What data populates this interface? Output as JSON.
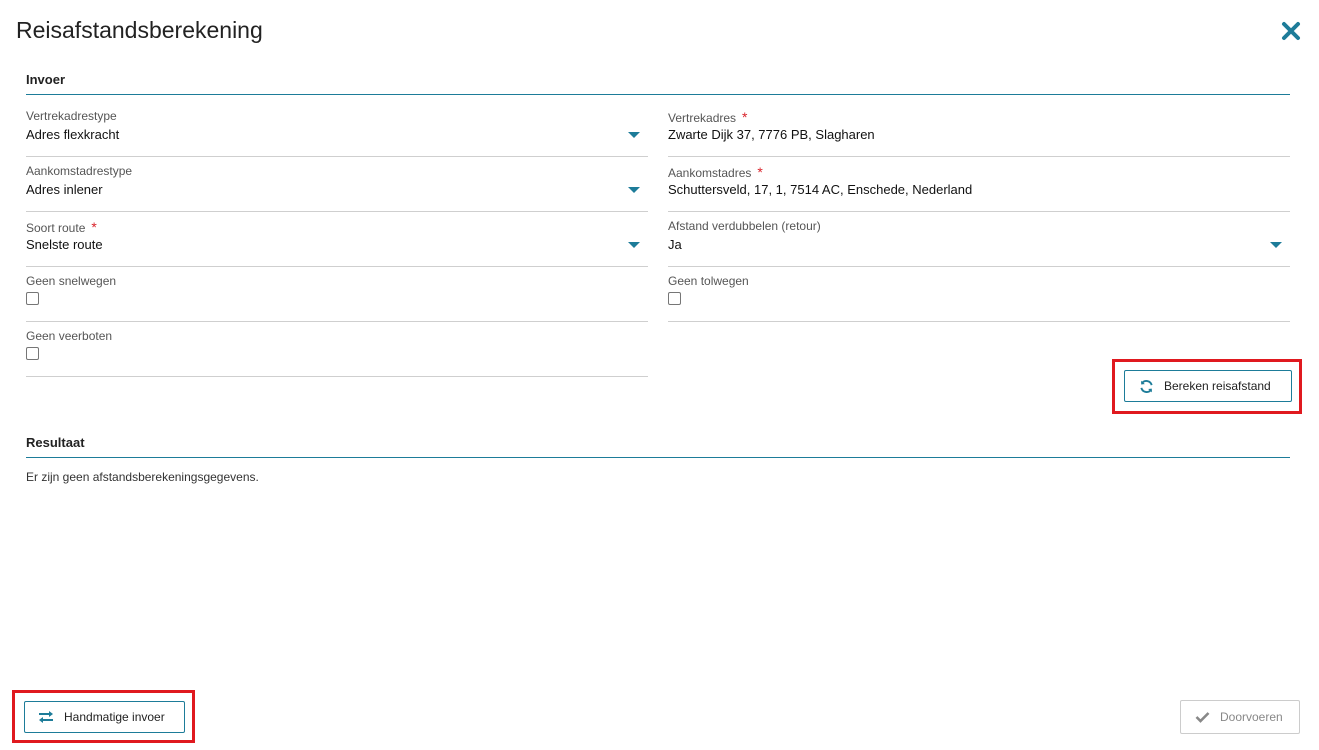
{
  "dialog": {
    "title": "Reisafstandsberekening"
  },
  "invoer": {
    "heading": "Invoer",
    "vertrekadrestype": {
      "label": "Vertrekadrestype",
      "value": "Adres flexkracht"
    },
    "vertrekadres": {
      "label": "Vertrekadres",
      "required": "*",
      "value": "Zwarte Dijk 37, 7776 PB, Slagharen"
    },
    "aankomstadrestype": {
      "label": "Aankomstadrestype",
      "value": "Adres inlener"
    },
    "aankomstadres": {
      "label": "Aankomstadres",
      "required": "*",
      "value": "Schuttersveld, 17, 1, 7514 AC, Enschede, Nederland"
    },
    "soort_route": {
      "label": "Soort route",
      "required": "*",
      "value": "Snelste route"
    },
    "afstand_verdubbelen": {
      "label": "Afstand verdubbelen (retour)",
      "value": "Ja"
    },
    "geen_snelwegen": {
      "label": "Geen snelwegen",
      "checked": false
    },
    "geen_tolwegen": {
      "label": "Geen tolwegen",
      "checked": false
    },
    "geen_veerboten": {
      "label": "Geen veerboten",
      "checked": false
    },
    "bereken_button": {
      "label": "Bereken reisafstand",
      "icon": "refresh-icon"
    }
  },
  "resultaat": {
    "heading": "Resultaat",
    "empty_text": "Er zijn geen afstandsberekeningsgegevens."
  },
  "footer": {
    "handmatig_button": {
      "label": "Handmatige invoer",
      "icon": "swap-arrows-icon"
    },
    "doorvoeren_button": {
      "label": "Doorvoeren",
      "icon": "check-icon"
    }
  },
  "colors": {
    "accent": "#1d7c99",
    "highlight": "#e0191f",
    "required": "#d9222a"
  }
}
